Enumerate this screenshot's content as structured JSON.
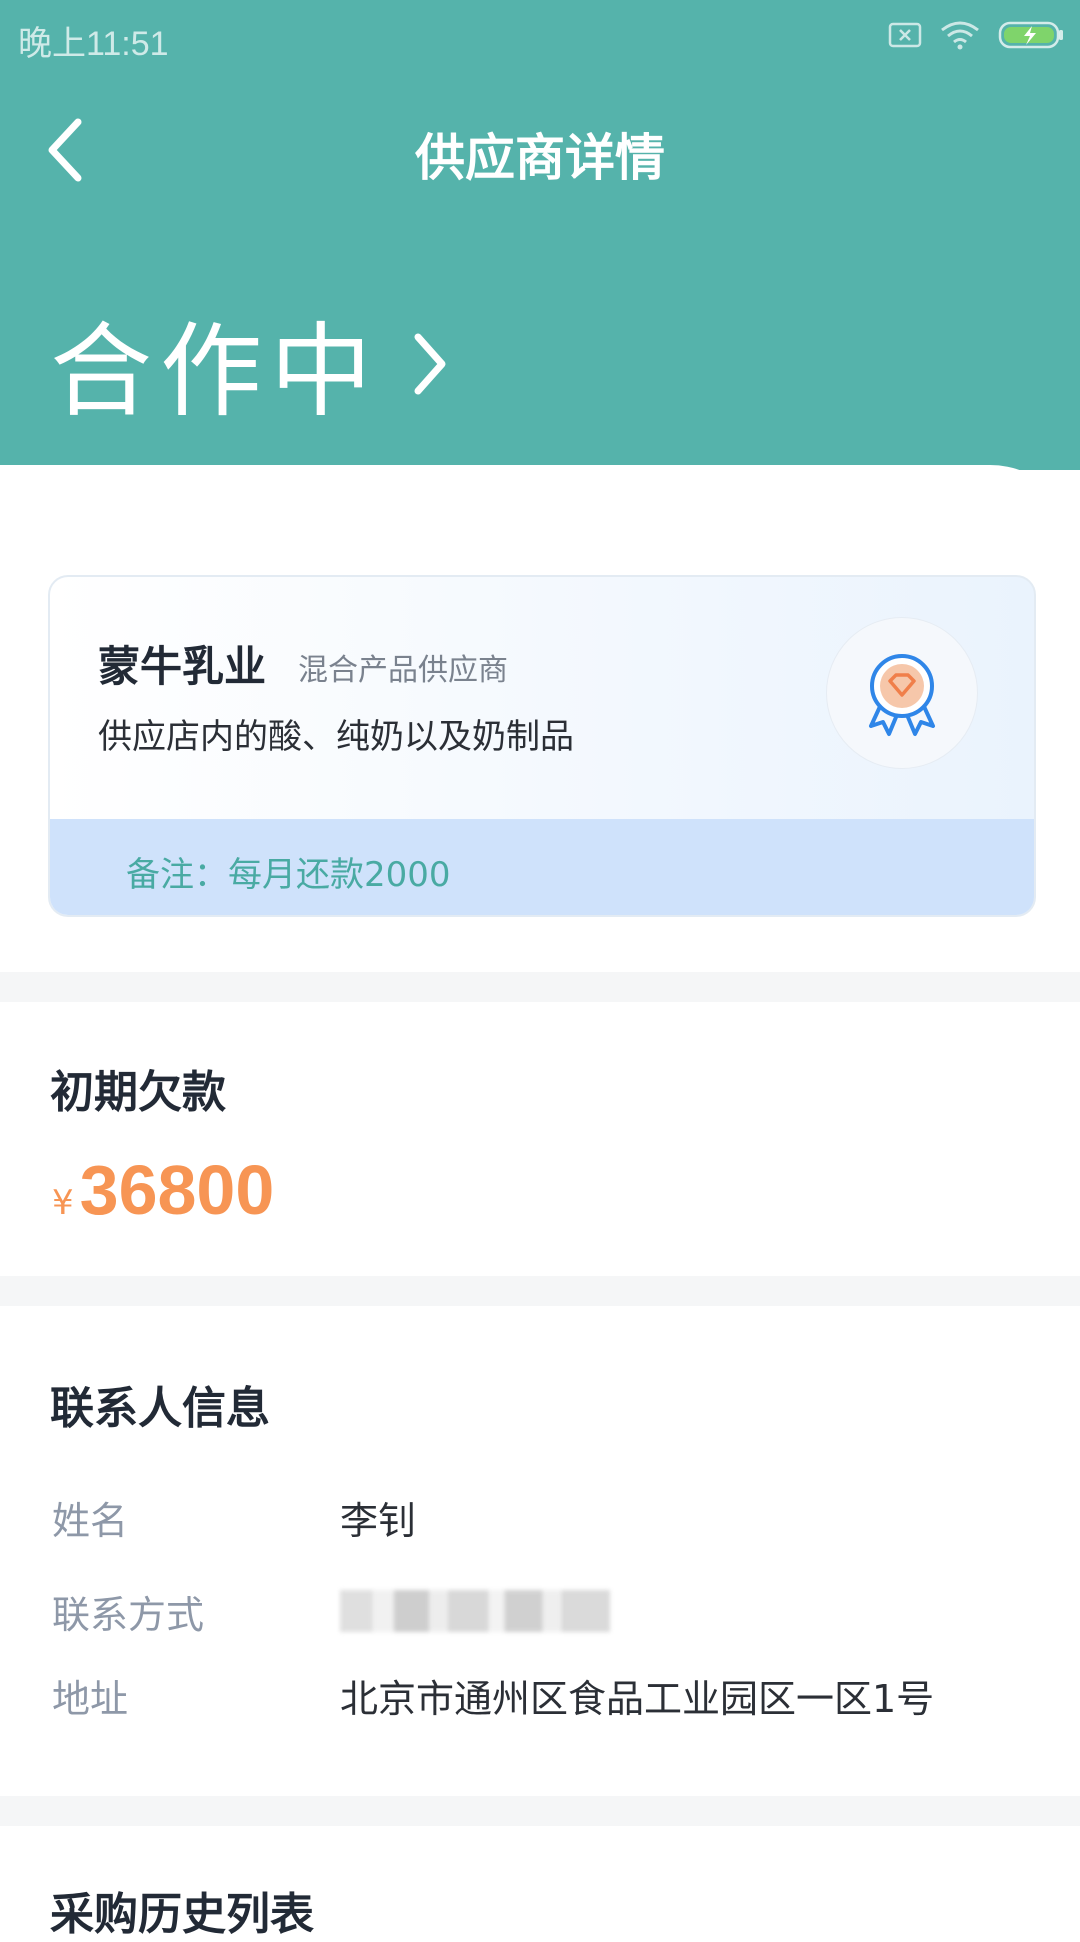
{
  "status_bar": {
    "time": "晚上11:51"
  },
  "nav": {
    "title": "供应商详情"
  },
  "cooperation": {
    "status": "合作中"
  },
  "supplier": {
    "name": "蒙牛乳业",
    "type": "混合产品供应商",
    "description": "供应店内的酸、纯奶以及奶制品",
    "note": "备注：每月还款2000"
  },
  "debt": {
    "title": "初期欠款",
    "currency": "¥",
    "amount": "36800"
  },
  "contact": {
    "title": "联系人信息",
    "rows": [
      {
        "label": "姓名",
        "value": "李钊"
      },
      {
        "label": "联系方式",
        "value": ""
      },
      {
        "label": "地址",
        "value": "北京市通州区食品工业园区一区1号"
      }
    ]
  },
  "history": {
    "title": "采购历史列表"
  },
  "colors": {
    "header": "#55b3ab",
    "amount": "#f79554",
    "note_bg": "#cfe2fb",
    "note_text": "#49aaa3"
  }
}
